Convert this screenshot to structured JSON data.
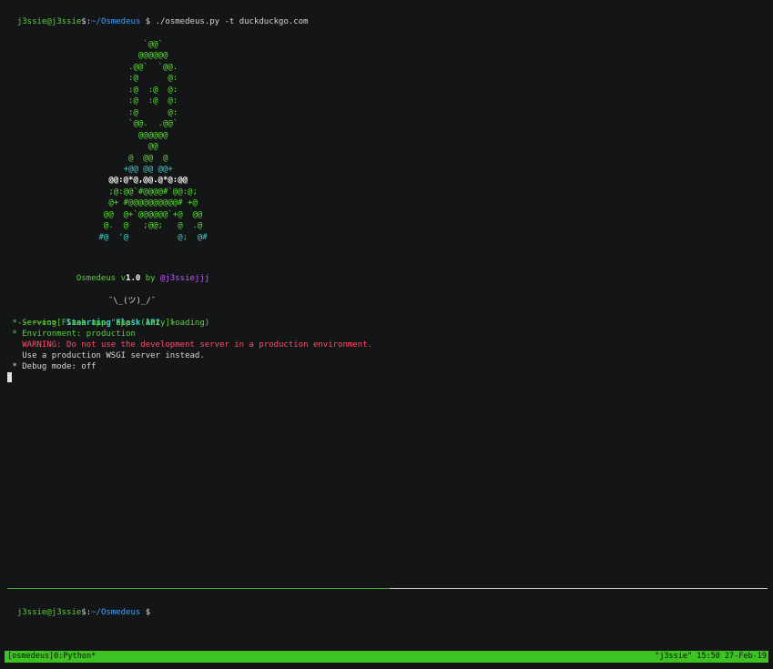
{
  "command_prompt": {
    "user_host": "j3ssie@j3ssie",
    "separator": "$:",
    "path": "~/Osmedeus",
    "symbol": "$",
    "command": "./osmedeus.py -t duckduckgo.com"
  },
  "ascii_art": [
    "               `@@`",
    "              @@@@@@",
    "            .@@`  `@@.",
    "            :@      @:",
    "            :@  :@  @:",
    "            :@  :@  @:",
    "            :@      @:",
    "            `@@.  .@@`",
    "              @@@@@@",
    "                @@",
    "            @  @@  @",
    "           +@@ @@ @@+",
    "        @@:@*@,@@.@*@:@@",
    "        ;@:@@`#@@@@#`@@:@;",
    "        @+ #@@@@@@@@@@# +@",
    "       @@  @+`@@@@@@`+@  @@",
    "       @.  @   ;@@;   @  .@",
    "      #@  '@          @;  @#"
  ],
  "banner": {
    "name": "Osmedeus",
    "v": "v",
    "version": "1.0",
    "by": "by",
    "author": "@j3ssiejjj",
    "shrug": "¯\\_(ツ)_/¯"
  },
  "api_line": {
    "prefix": "--~~~=:>[ ",
    "text": "Staarting Flask API",
    "suffix": " ]>"
  },
  "flask_lines": {
    "serving": " * Serving Flask app \"app\" (lazy loading)",
    "environment": " * Environment: production",
    "warning": "   WARNING: Do not use the development server in a production environment.",
    "use_wsgi": "   Use a production WSGI server instead.",
    "debug": " * Debug mode: off"
  },
  "bottom_prompt": {
    "user_host": "j3ssie@j3ssie",
    "separator": "$:",
    "path": "~/Osmedeus",
    "symbol": "$"
  },
  "statusbar": {
    "left": "[osmedeus]0:Python*",
    "right": "\"j3ssie\" 15:50 27-Feb-19"
  },
  "colors": {
    "background": "#141516",
    "green": "#5bd03a",
    "status_bg": "#3cc221",
    "warning": "#ff4d6a",
    "path": "#3fa4ff"
  }
}
